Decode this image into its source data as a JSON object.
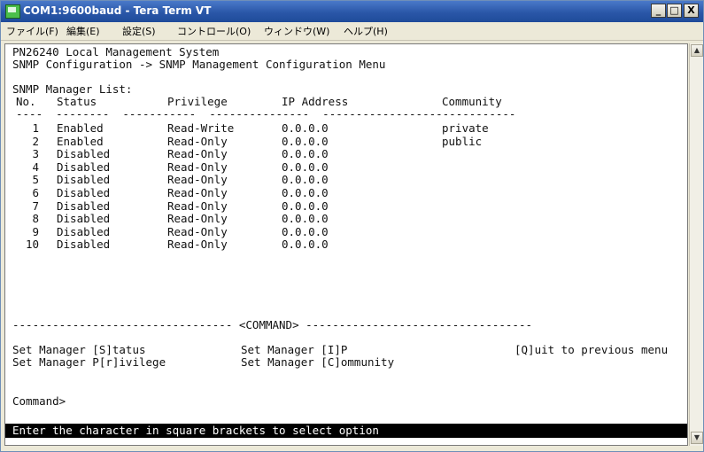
{
  "window": {
    "title": "COM1:9600baud - Tera Term VT",
    "minimize_label": "_",
    "maximize_label": "□",
    "close_label": "X"
  },
  "menu": [
    {
      "label": "ファイル(F)"
    },
    {
      "label": "編集(E)"
    },
    {
      "label": "設定(S)"
    },
    {
      "label": "コントロール(O)"
    },
    {
      "label": "ウィンドウ(W)"
    },
    {
      "label": "ヘルプ(H)"
    }
  ],
  "terminal": {
    "system_title": "PN26240 Local Management System",
    "breadcrumb": "SNMP Configuration -> SNMP Management Configuration Menu",
    "list_title": "SNMP Manager List:",
    "headers": {
      "no": "No.",
      "status": "Status",
      "privilege": "Privilege",
      "ip": "IP Address",
      "community": "Community"
    },
    "underline": "----  --------  -----------  ---------------  -----------------------------",
    "rows": [
      {
        "no": "1",
        "status": "Enabled",
        "privilege": "Read-Write",
        "ip": "0.0.0.0",
        "community": "private"
      },
      {
        "no": "2",
        "status": "Enabled",
        "privilege": "Read-Only",
        "ip": "0.0.0.0",
        "community": "public"
      },
      {
        "no": "3",
        "status": "Disabled",
        "privilege": "Read-Only",
        "ip": "0.0.0.0",
        "community": ""
      },
      {
        "no": "4",
        "status": "Disabled",
        "privilege": "Read-Only",
        "ip": "0.0.0.0",
        "community": ""
      },
      {
        "no": "5",
        "status": "Disabled",
        "privilege": "Read-Only",
        "ip": "0.0.0.0",
        "community": ""
      },
      {
        "no": "6",
        "status": "Disabled",
        "privilege": "Read-Only",
        "ip": "0.0.0.0",
        "community": ""
      },
      {
        "no": "7",
        "status": "Disabled",
        "privilege": "Read-Only",
        "ip": "0.0.0.0",
        "community": ""
      },
      {
        "no": "8",
        "status": "Disabled",
        "privilege": "Read-Only",
        "ip": "0.0.0.0",
        "community": ""
      },
      {
        "no": "9",
        "status": "Disabled",
        "privilege": "Read-Only",
        "ip": "0.0.0.0",
        "community": ""
      },
      {
        "no": "10",
        "status": "Disabled",
        "privilege": "Read-Only",
        "ip": "0.0.0.0",
        "community": ""
      }
    ],
    "command_divider": "--------------------------------- <COMMAND> ----------------------------------",
    "commands": {
      "set_status": "Set Manager [S]tatus",
      "set_ip": "Set Manager [I]P",
      "quit": "[Q]uit to previous menu",
      "set_privilege": "Set Manager P[r]ivilege",
      "set_community": "Set Manager [C]ommunity"
    },
    "prompt": "Command>",
    "status_message": "Enter the character in square brackets to select option"
  },
  "scrollbar": {
    "up_arrow": "▲",
    "down_arrow": "▼"
  }
}
